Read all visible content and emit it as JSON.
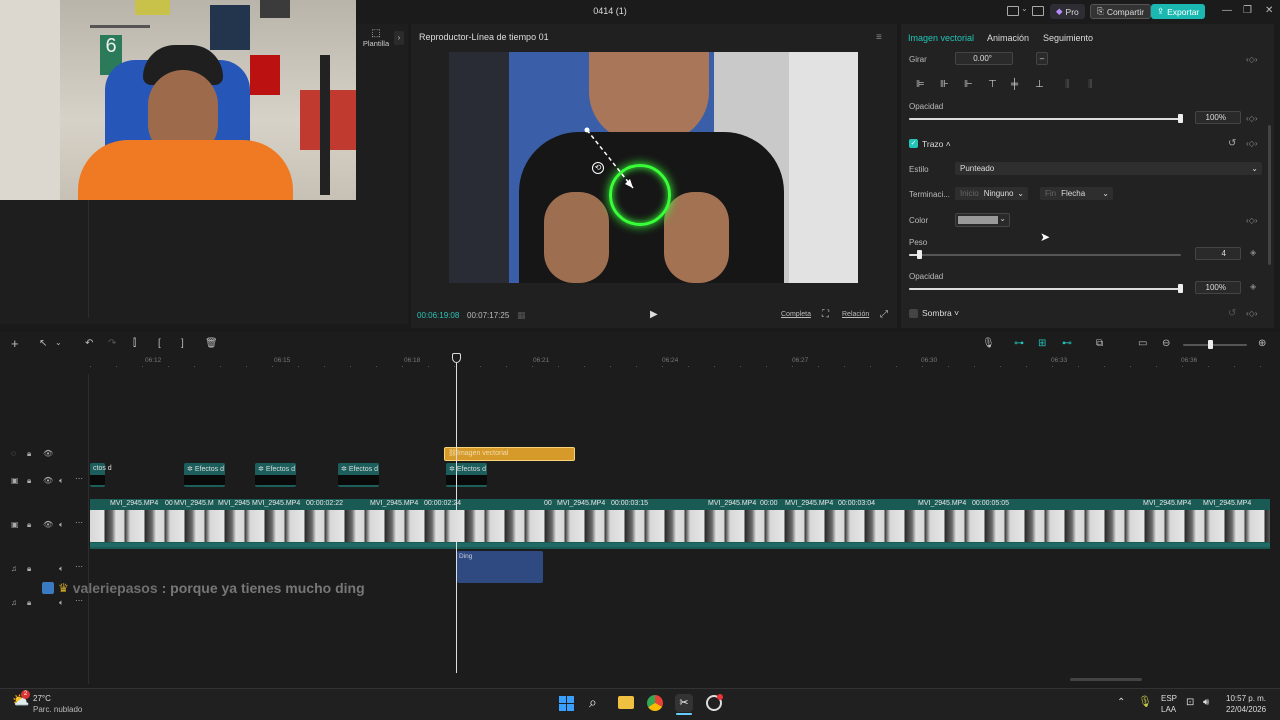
{
  "window": {
    "title": "0414 (1)",
    "pro_label": "Pro",
    "share_label": "Compartir",
    "export_label": "Exportar"
  },
  "left_panel": {
    "template_label": "Plantilla"
  },
  "player": {
    "title": "Reproductor-Línea de tiempo 01",
    "current_time": "00:06:19:08",
    "total_time": "00:07:17:25",
    "full_label": "Completa",
    "ratio_label": "Relación"
  },
  "inspector": {
    "tabs": [
      "Imagen vectorial",
      "Animación",
      "Seguimiento"
    ],
    "rotate_label": "Girar",
    "rotate_value": "0.00°",
    "rotate_dash": "–",
    "opacity_label": "Opacidad",
    "opacity_value": "100%",
    "stroke_label": "Trazo",
    "style_label": "Estilo",
    "style_value": "Punteado",
    "termination_label": "Terminaci...",
    "start_label": "Inicio",
    "start_value": "Ninguno",
    "end_label": "Fin",
    "end_value": "Flecha",
    "color_label": "Color",
    "weight_label": "Peso",
    "weight_value": "4",
    "opacity2_label": "Opacidad",
    "opacity2_value": "100%",
    "shadow_label": "Sombra",
    "opacity_level": 1.0,
    "weight_level": 0.04
  },
  "timeline": {
    "ticks": [
      "06:12",
      "06:15",
      "06:18",
      "06:21",
      "06:24",
      "06:27",
      "06:30",
      "06:33",
      "06:36"
    ],
    "effects_label": "Efectos d",
    "effects_label_first": "ctos d",
    "vector_clip_label": "Imagen vectorial",
    "audio_clip_label": "Ding",
    "video_labels": [
      "MVI_2945.MP4",
      "00",
      "MVI_2945.M",
      "MVI_2945",
      "MVI_2945.MP4",
      "00:00:02:22",
      "MVI_2945.MP4",
      "00:00:02:24",
      "00",
      "MVI_2945.MP4",
      "00:00:03:15",
      "MVI_2945.MP4",
      "00:00",
      "MVI_2945.MP4",
      "00:00:03:04",
      "MVI_2945.MP4",
      "00:00:05:05",
      "MVI_2945.MP4",
      "MVI_2945.MP4"
    ]
  },
  "chat": {
    "user": "valeriepasos",
    "message": ": porque ya tienes mucho ding"
  },
  "taskbar": {
    "temperature": "27°C",
    "weather": "Parc. nublado",
    "weather_badge": "2",
    "lang_top": "ESP",
    "lang_bottom": "LAA",
    "time": "10:57 p. m.",
    "date": "22/04/2026"
  },
  "colors": {
    "accent": "#22c4b8",
    "export_bg": "#1ab8b0",
    "vector_clip": "#d69a2a",
    "effects_clip": "#1b5e5b",
    "audio_clip": "#2e4a80",
    "stroke_color": "#9a9a9a"
  }
}
